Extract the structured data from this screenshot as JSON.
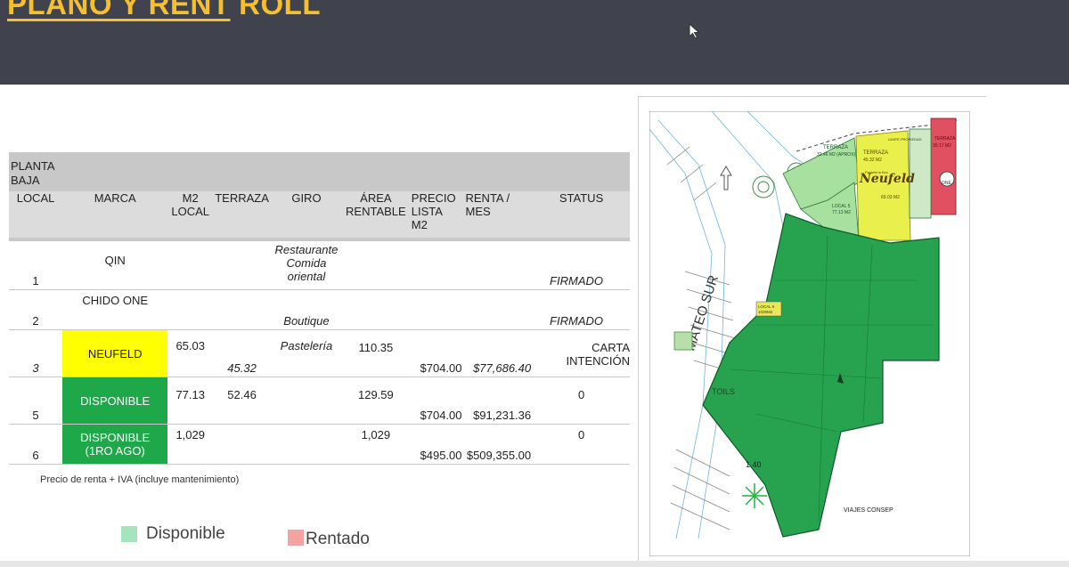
{
  "header": {
    "title_part1": "PLANO Y RENT",
    "title_part2": " ROLL"
  },
  "table": {
    "section_label": "PLANTA BAJA",
    "columns": [
      "LOCAL",
      "MARCA",
      "M2 LOCAL",
      "TERRAZA",
      "GIRO",
      "ÁREA RENTABLE",
      "PRECIO LISTA M2",
      "RENTA / MES",
      "STATUS"
    ],
    "rows": [
      {
        "local": "1",
        "marca": "QIN",
        "m2": "",
        "terraza": "",
        "giro": "Restaurante Comida oriental",
        "area": "",
        "precio": "",
        "renta": "",
        "status": "FIRMADO"
      },
      {
        "local": "2",
        "marca": "CHIDO ONE",
        "m2": "",
        "terraza": "",
        "giro": "Boutique",
        "area": "",
        "precio": "",
        "renta": "",
        "status": "FIRMADO"
      },
      {
        "local": "3",
        "marca": "NEUFELD",
        "m2": "65.03",
        "terraza": "45.32",
        "giro": "Pastelería",
        "area": "110.35",
        "precio": "$704.00",
        "renta": "$77,686.40",
        "status": "CARTA INTENCIÓN"
      },
      {
        "local": "5",
        "marca": "DISPONIBLE",
        "m2": "77.13",
        "terraza": "52.46",
        "giro": "",
        "area": "129.59",
        "precio": "$704.00",
        "renta": "$91,231.36",
        "status": "0"
      },
      {
        "local": "6",
        "marca": "DISPONIBLE (1RO AGO)",
        "m2": "1,029",
        "terraza": "",
        "giro": "",
        "area": "1,029",
        "precio": "$495.00",
        "renta": "$509,355.00",
        "status": "0"
      }
    ]
  },
  "note": "Precio de renta + IVA (incluye mantenimiento)",
  "legend": [
    {
      "label": "Disponible",
      "color": "#a6e4c0"
    },
    {
      "label": "Rentado",
      "color": "#f4a3a3"
    }
  ],
  "plan": {
    "street_label": "MATEO SUR",
    "terraza_label": "TERRAZA",
    "terraza_1_area": "32.46 M2 (APROX)",
    "terraza_2_area": "45.32 M2",
    "terraza_3_area": "30.17 M2",
    "local5_label": "LOCAL 5",
    "local5_area": "77.13 M2",
    "local3_area": "65.03 M2",
    "neufeld_brand": "Neufeld",
    "neufeld_sub": "Pastelería fina",
    "chido_label": "ONE",
    "local6_label": "LOCAL 6",
    "local6_area": "1029M2",
    "toilets_label": "TOILS",
    "dim_label": "1.40",
    "viajes_label": "VIAJES CONSEP",
    "limite_label": "LIMITE PROPIEDAD"
  },
  "colors": {
    "header_bg": "#40434d",
    "title": "#f5bf2e",
    "available_green": "#1fa84a",
    "intent_yellow": "#ffff00",
    "plan_green": "#27a24f",
    "plan_light_green": "#a8e0a0",
    "plan_red": "#e05060"
  }
}
